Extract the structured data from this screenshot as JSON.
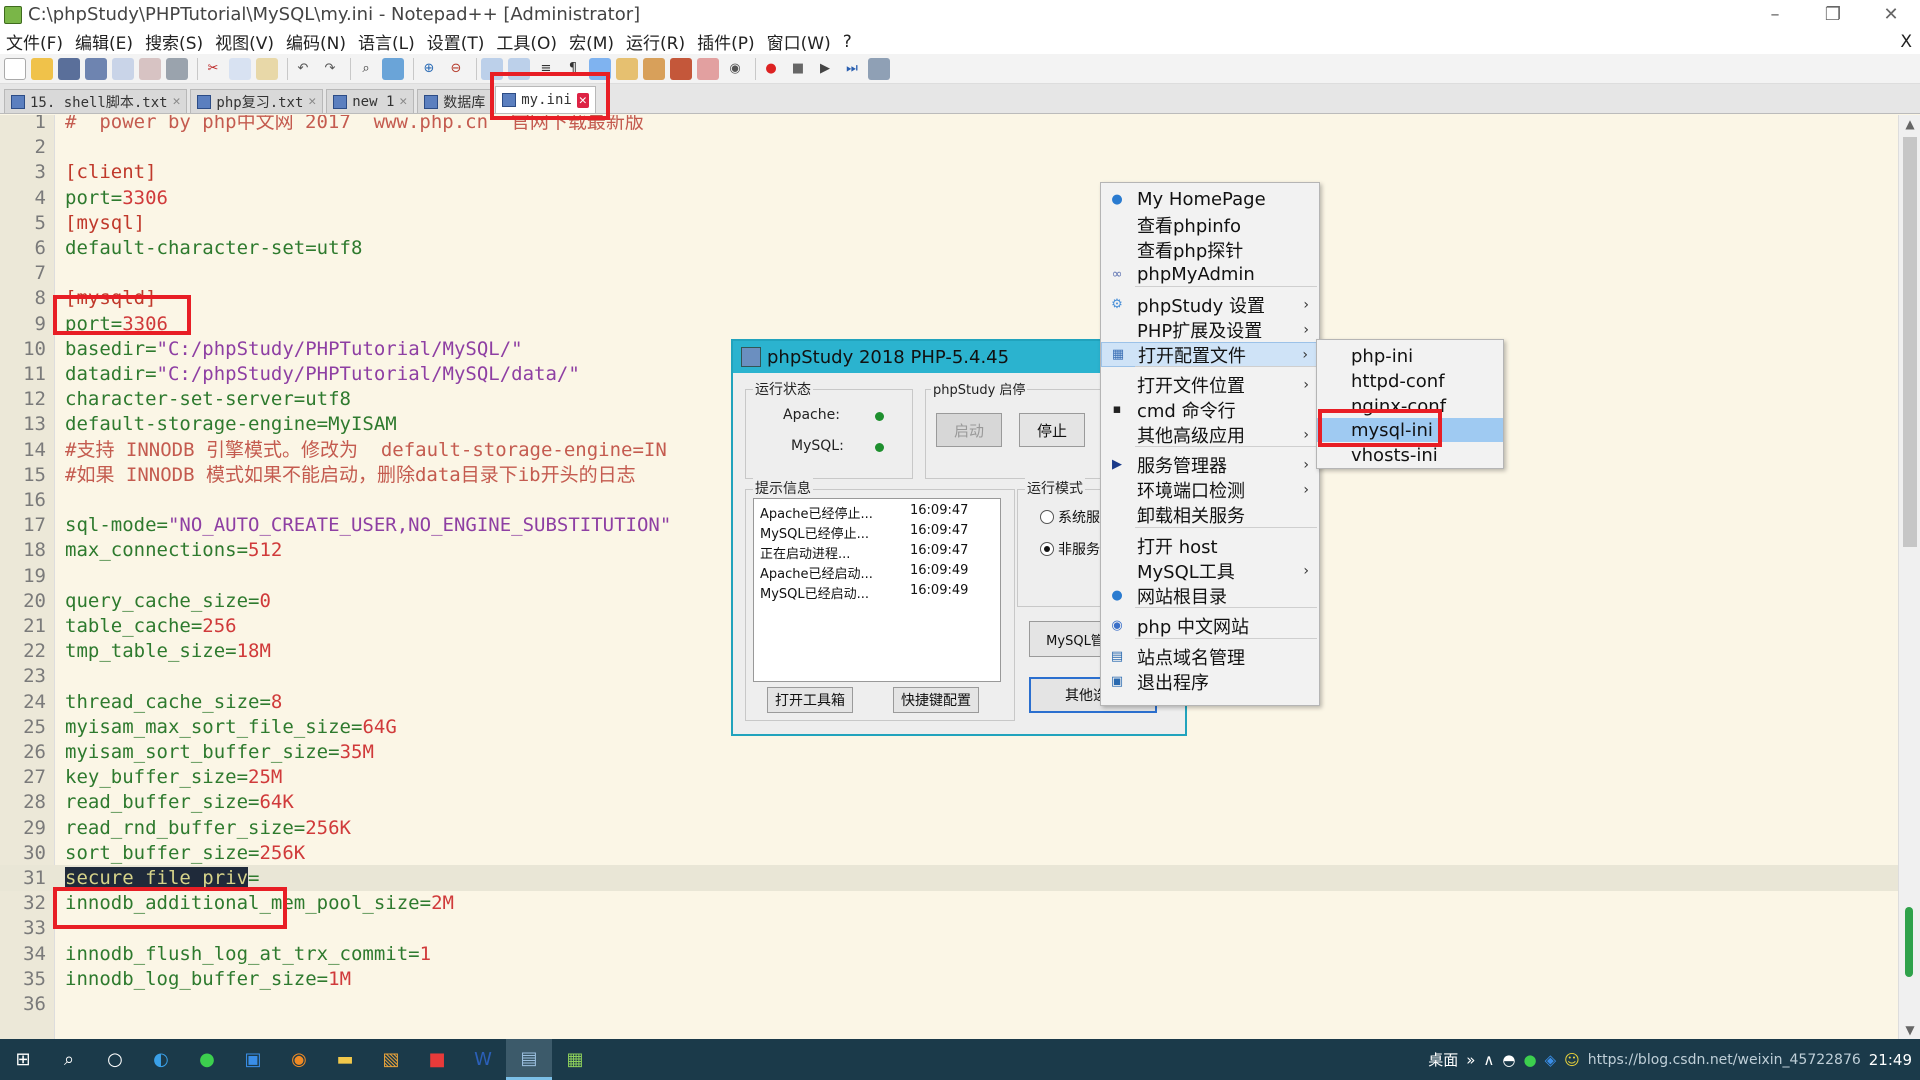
{
  "window": {
    "title": "C:\\phpStudy\\PHPTutorial\\MySQL\\my.ini - Notepad++ [Administrator]",
    "minimize_icon": "minimize-icon",
    "restore_icon": "restore-icon",
    "close_icon": "close-icon"
  },
  "menubar": {
    "items": [
      "文件(F)",
      "编辑(E)",
      "搜索(S)",
      "视图(V)",
      "编码(N)",
      "语言(L)",
      "设置(T)",
      "工具(O)",
      "宏(M)",
      "运行(R)",
      "插件(P)",
      "窗口(W)",
      "?"
    ],
    "close_label": "X"
  },
  "tabs": [
    {
      "label": "15. shell脚本.txt",
      "active": false
    },
    {
      "label": "php复习.txt",
      "active": false
    },
    {
      "label": "new 1",
      "active": false
    },
    {
      "label": "数据库",
      "active": false
    },
    {
      "label": "my.ini",
      "active": true
    }
  ],
  "editor": {
    "current_line": 31,
    "lines": [
      {
        "n": "1",
        "parts": [
          {
            "t": "#  power by php中文网 2017  www.php.cn  官网下载最新版",
            "c": "comment"
          }
        ]
      },
      {
        "n": "2",
        "parts": []
      },
      {
        "n": "3",
        "parts": [
          {
            "t": "[client]",
            "c": "sec"
          }
        ]
      },
      {
        "n": "4",
        "parts": [
          {
            "t": "port",
            "c": "key"
          },
          {
            "t": "=",
            "c": "key"
          },
          {
            "t": "3306",
            "c": "val"
          }
        ]
      },
      {
        "n": "5",
        "parts": [
          {
            "t": "[mysql]",
            "c": "sec"
          }
        ]
      },
      {
        "n": "6",
        "parts": [
          {
            "t": "default-character-set",
            "c": "key"
          },
          {
            "t": "=utf8",
            "c": "key"
          }
        ]
      },
      {
        "n": "7",
        "parts": []
      },
      {
        "n": "8",
        "parts": [
          {
            "t": "[mysqld]",
            "c": "sec"
          }
        ]
      },
      {
        "n": "9",
        "parts": [
          {
            "t": "port",
            "c": "key"
          },
          {
            "t": "=",
            "c": "key"
          },
          {
            "t": "3306",
            "c": "val"
          }
        ]
      },
      {
        "n": "10",
        "parts": [
          {
            "t": "basedir",
            "c": "key"
          },
          {
            "t": "=",
            "c": "key"
          },
          {
            "t": "\"C:/phpStudy/PHPTutorial/MySQL/\"",
            "c": "str"
          }
        ]
      },
      {
        "n": "11",
        "parts": [
          {
            "t": "datadir",
            "c": "key"
          },
          {
            "t": "=",
            "c": "key"
          },
          {
            "t": "\"C:/phpStudy/PHPTutorial/MySQL/data/\"",
            "c": "str"
          }
        ]
      },
      {
        "n": "12",
        "parts": [
          {
            "t": "character-set-server",
            "c": "key"
          },
          {
            "t": "=utf8",
            "c": "key"
          }
        ]
      },
      {
        "n": "13",
        "parts": [
          {
            "t": "default-storage-engine",
            "c": "key"
          },
          {
            "t": "=MyISAM",
            "c": "key"
          }
        ]
      },
      {
        "n": "14",
        "parts": [
          {
            "t": "#支持 INNODB 引擎模式。修改为  default-storage-engine=IN",
            "c": "comment"
          }
        ]
      },
      {
        "n": "15",
        "parts": [
          {
            "t": "#如果 INNODB 模式如果不能启动，删除data目录下ib开头的日志",
            "c": "comment"
          }
        ]
      },
      {
        "n": "16",
        "parts": []
      },
      {
        "n": "17",
        "parts": [
          {
            "t": "sql-mode",
            "c": "key"
          },
          {
            "t": "=",
            "c": "key"
          },
          {
            "t": "\"NO_AUTO_CREATE_USER,NO_ENGINE_SUBSTITUTION\"",
            "c": "str"
          }
        ]
      },
      {
        "n": "18",
        "parts": [
          {
            "t": "max_connections",
            "c": "key"
          },
          {
            "t": "=",
            "c": "key"
          },
          {
            "t": "512",
            "c": "val"
          }
        ]
      },
      {
        "n": "19",
        "parts": []
      },
      {
        "n": "20",
        "parts": [
          {
            "t": "query_cache_size",
            "c": "key"
          },
          {
            "t": "=",
            "c": "key"
          },
          {
            "t": "0",
            "c": "val"
          }
        ]
      },
      {
        "n": "21",
        "parts": [
          {
            "t": "table_cache",
            "c": "key"
          },
          {
            "t": "=",
            "c": "key"
          },
          {
            "t": "256",
            "c": "val"
          }
        ]
      },
      {
        "n": "22",
        "parts": [
          {
            "t": "tmp_table_size",
            "c": "key"
          },
          {
            "t": "=",
            "c": "key"
          },
          {
            "t": "18M",
            "c": "val"
          }
        ]
      },
      {
        "n": "23",
        "parts": []
      },
      {
        "n": "24",
        "parts": [
          {
            "t": "thread_cache_size",
            "c": "key"
          },
          {
            "t": "=",
            "c": "key"
          },
          {
            "t": "8",
            "c": "val"
          }
        ]
      },
      {
        "n": "25",
        "parts": [
          {
            "t": "myisam_max_sort_file_size",
            "c": "key"
          },
          {
            "t": "=",
            "c": "key"
          },
          {
            "t": "64G",
            "c": "val"
          }
        ]
      },
      {
        "n": "26",
        "parts": [
          {
            "t": "myisam_sort_buffer_size",
            "c": "key"
          },
          {
            "t": "=",
            "c": "key"
          },
          {
            "t": "35M",
            "c": "val"
          }
        ]
      },
      {
        "n": "27",
        "parts": [
          {
            "t": "key_buffer_size",
            "c": "key"
          },
          {
            "t": "=",
            "c": "key"
          },
          {
            "t": "25M",
            "c": "val"
          }
        ]
      },
      {
        "n": "28",
        "parts": [
          {
            "t": "read_buffer_size",
            "c": "key"
          },
          {
            "t": "=",
            "c": "key"
          },
          {
            "t": "64K",
            "c": "val"
          }
        ]
      },
      {
        "n": "29",
        "parts": [
          {
            "t": "read_rnd_buffer_size",
            "c": "key"
          },
          {
            "t": "=",
            "c": "key"
          },
          {
            "t": "256K",
            "c": "val"
          }
        ]
      },
      {
        "n": "30",
        "parts": [
          {
            "t": "sort_buffer_size",
            "c": "key"
          },
          {
            "t": "=",
            "c": "key"
          },
          {
            "t": "256K",
            "c": "val"
          }
        ]
      },
      {
        "n": "31",
        "parts": [
          {
            "t": "secure_file_priv",
            "c": "sel"
          },
          {
            "t": "=",
            "c": "key"
          }
        ]
      },
      {
        "n": "32",
        "parts": [
          {
            "t": "innodb_additional_mem_pool_size",
            "c": "key"
          },
          {
            "t": "=",
            "c": "key"
          },
          {
            "t": "2M",
            "c": "val"
          }
        ]
      },
      {
        "n": "33",
        "parts": []
      },
      {
        "n": "34",
        "parts": [
          {
            "t": "innodb_flush_log_at_trx_commit",
            "c": "key"
          },
          {
            "t": "=",
            "c": "key"
          },
          {
            "t": "1",
            "c": "val"
          }
        ]
      },
      {
        "n": "35",
        "parts": [
          {
            "t": "innodb_log_buffer_size",
            "c": "key"
          },
          {
            "t": "=",
            "c": "key"
          },
          {
            "t": "1M",
            "c": "val"
          }
        ]
      },
      {
        "n": "36",
        "parts": []
      }
    ]
  },
  "phpstudy": {
    "title": "phpStudy 2018   PHP-5.4.45",
    "run_status_label": "运行状态",
    "apache_label": "Apache:",
    "mysql_label": "MySQL:",
    "control_label": "phpStudy 启停",
    "start_label": "启动",
    "stop_label": "停止",
    "info_label": "提示信息",
    "logs": [
      {
        "msg": "Apache已经停止...",
        "time": "16:09:47"
      },
      {
        "msg": "MySQL已经停止...",
        "time": "16:09:47"
      },
      {
        "msg": "正在启动进程...",
        "time": "16:09:47"
      },
      {
        "msg": "Apache已经启动...",
        "time": "16:09:49"
      },
      {
        "msg": "MySQL已经启动...",
        "time": "16:09:49"
      }
    ],
    "mode_label": "运行模式",
    "mode_system": "系统服",
    "mode_nonservice": "非服务",
    "mysql_manage_label": "MySQL管",
    "toolbox_label": "打开工具箱",
    "shortcut_label": "快捷键配置",
    "other_label": "其他选项"
  },
  "context_menu": {
    "items": [
      {
        "label": "My HomePage",
        "icon": "globe-icon",
        "arrow": false
      },
      {
        "label": "查看phpinfo",
        "icon": "",
        "arrow": false
      },
      {
        "label": "查看php探针",
        "icon": "",
        "arrow": false
      },
      {
        "label": "phpMyAdmin",
        "icon": "phpmyadmin-icon",
        "arrow": false
      },
      {
        "label": "phpStudy 设置",
        "icon": "gear-icon",
        "arrow": true
      },
      {
        "label": "PHP扩展及设置",
        "icon": "",
        "arrow": true
      },
      {
        "label": "打开配置文件",
        "icon": "config-icon",
        "arrow": true
      },
      {
        "label": "打开文件位置",
        "icon": "",
        "arrow": true
      },
      {
        "label": "cmd 命令行",
        "icon": "terminal-icon",
        "arrow": false
      },
      {
        "label": "其他高级应用",
        "icon": "",
        "arrow": true
      },
      {
        "label": "服务管理器",
        "icon": "triangle-icon",
        "arrow": true
      },
      {
        "label": "环境端口检测",
        "icon": "",
        "arrow": true
      },
      {
        "label": "卸载相关服务",
        "icon": "",
        "arrow": false
      },
      {
        "label": "打开 host",
        "icon": "",
        "arrow": false
      },
      {
        "label": "MySQL工具",
        "icon": "",
        "arrow": true
      },
      {
        "label": "网站根目录",
        "icon": "globe-icon",
        "arrow": false
      },
      {
        "label": "php 中文网站",
        "icon": "php-icon",
        "arrow": false
      },
      {
        "label": "站点域名管理",
        "icon": "sitemap-icon",
        "arrow": false
      },
      {
        "label": "退出程序",
        "icon": "exit-icon",
        "arrow": false
      }
    ]
  },
  "submenu": {
    "items": [
      "php-ini",
      "httpd-conf",
      "nginx-conf",
      "mysql-ini",
      "vhosts-ini"
    ],
    "active": "mysql-ini"
  },
  "taskbar": {
    "desktop_label": "桌面",
    "watermark": "https://blog.csdn.net/weixin_45722876",
    "time": "21:49"
  },
  "colors": {
    "editor_bg": "#fbf6e6",
    "highlight_red": "#e81e25",
    "phpstudy_title": "#2bb3cf",
    "taskbar": "#1b3a4a"
  }
}
